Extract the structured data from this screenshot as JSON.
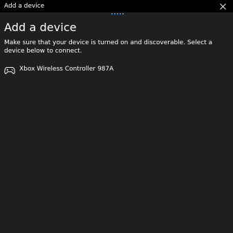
{
  "window": {
    "title": "Add a device",
    "close_icon": "close-icon"
  },
  "main": {
    "heading": "Add a device",
    "description": "Make sure that your device is turned on and discoverable. Select a device below to connect.",
    "progress_indicator": "searching-dots"
  },
  "devices": [
    {
      "icon": "gamepad-icon",
      "name": "Xbox Wireless Controller 987A"
    }
  ],
  "colors": {
    "background": "#1f1f1f",
    "titlebar": "#000000",
    "accent": "#4aa0ff",
    "text": "#ffffff"
  }
}
